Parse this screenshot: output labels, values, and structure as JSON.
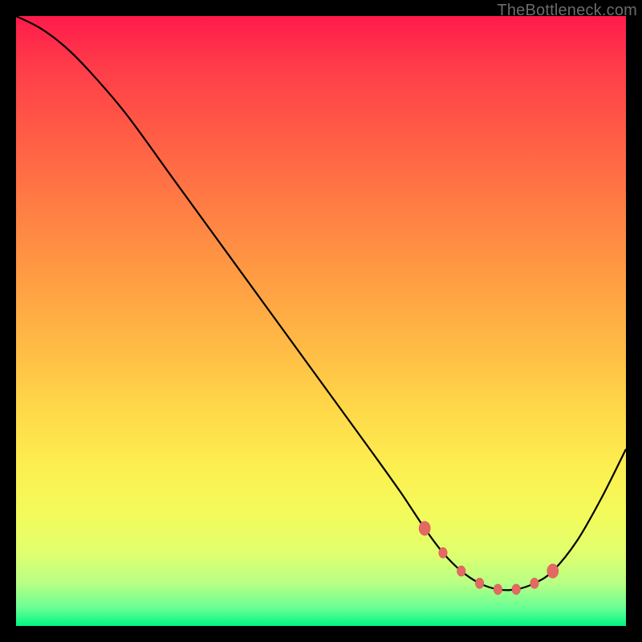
{
  "watermark": "TheBottleneck.com",
  "colors": {
    "curve_stroke": "#000000",
    "marker_fill": "#e36a63",
    "marker_stroke": "#d85a55"
  },
  "chart_data": {
    "type": "line",
    "title": "",
    "xlabel": "",
    "ylabel": "",
    "xlim": [
      0,
      100
    ],
    "ylim": [
      0,
      100
    ],
    "grid": false,
    "curve": {
      "x": [
        0,
        4,
        8,
        12,
        18,
        26,
        34,
        42,
        50,
        58,
        63,
        67,
        70,
        73,
        76,
        79,
        82,
        85,
        88,
        92,
        96,
        100
      ],
      "y": [
        100,
        98,
        95,
        91,
        84,
        73,
        62,
        51,
        40,
        29,
        22,
        16,
        12,
        9,
        7,
        6,
        6,
        7,
        9,
        14,
        21,
        29
      ]
    },
    "markers": {
      "x": [
        67,
        70,
        73,
        76,
        79,
        82,
        85,
        88
      ],
      "y": [
        16,
        12,
        9,
        7,
        6,
        6,
        7,
        9
      ]
    }
  }
}
